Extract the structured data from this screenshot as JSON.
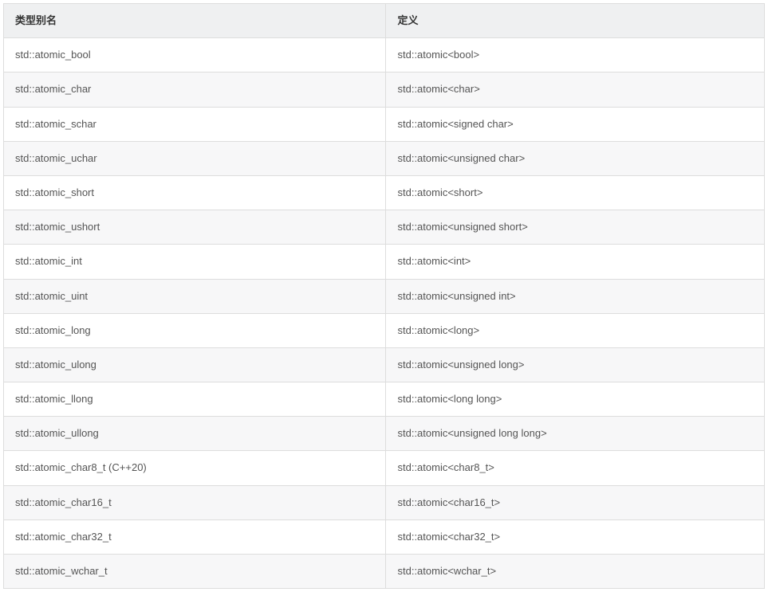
{
  "table": {
    "headers": {
      "alias": "类型别名",
      "definition": "定义"
    },
    "rows": [
      {
        "alias": "std::atomic_bool",
        "definition": "std::atomic<bool>"
      },
      {
        "alias": "std::atomic_char",
        "definition": "std::atomic<char>"
      },
      {
        "alias": "std::atomic_schar",
        "definition": "std::atomic<signed char>"
      },
      {
        "alias": "std::atomic_uchar",
        "definition": "std::atomic<unsigned char>"
      },
      {
        "alias": "std::atomic_short",
        "definition": "std::atomic<short>"
      },
      {
        "alias": "std::atomic_ushort",
        "definition": "std::atomic<unsigned short>"
      },
      {
        "alias": "std::atomic_int",
        "definition": "std::atomic<int>"
      },
      {
        "alias": "std::atomic_uint",
        "definition": "std::atomic<unsigned int>"
      },
      {
        "alias": "std::atomic_long",
        "definition": "std::atomic<long>"
      },
      {
        "alias": "std::atomic_ulong",
        "definition": "std::atomic<unsigned long>"
      },
      {
        "alias": "std::atomic_llong",
        "definition": "std::atomic<long long>"
      },
      {
        "alias": "std::atomic_ullong",
        "definition": "std::atomic<unsigned long long>"
      },
      {
        "alias": "std::atomic_char8_t (C++20)",
        "definition": "std::atomic<char8_t>"
      },
      {
        "alias": "std::atomic_char16_t",
        "definition": "std::atomic<char16_t>"
      },
      {
        "alias": "std::atomic_char32_t",
        "definition": "std::atomic<char32_t>"
      },
      {
        "alias": "std::atomic_wchar_t",
        "definition": "std::atomic<wchar_t>"
      }
    ]
  }
}
